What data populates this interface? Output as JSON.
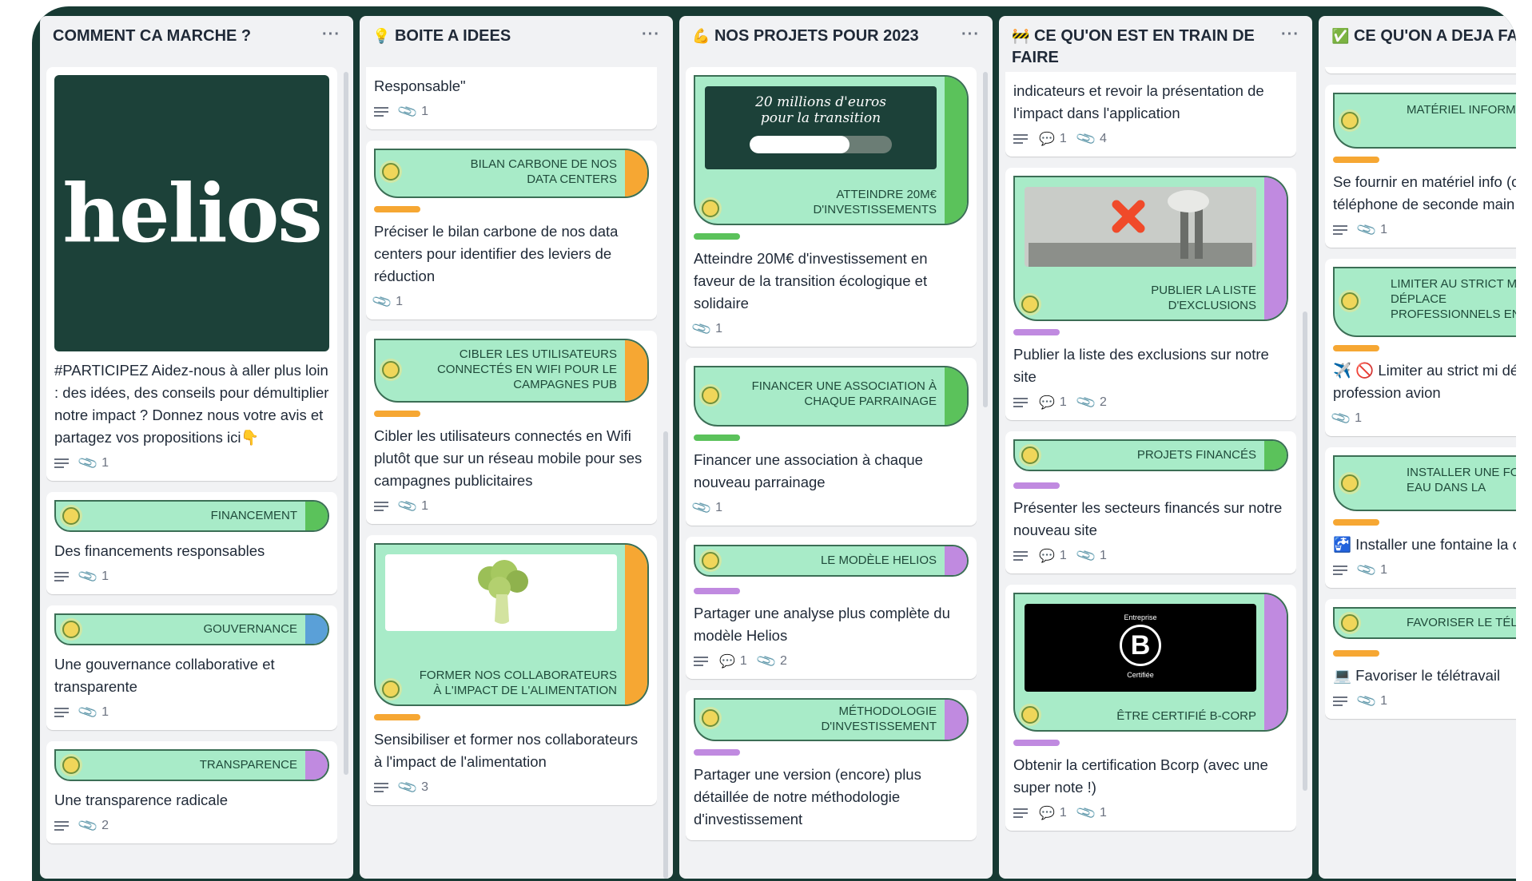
{
  "colors": {
    "frame": "#173a33",
    "banner": "#a8ebc8",
    "green": "#5bc25b",
    "blue": "#5aa0d8",
    "purple": "#c08ae0",
    "orange": "#f6a733"
  },
  "columns": [
    {
      "title": "COMMENT CA MARCHE ?",
      "icon": "",
      "cards": [
        {
          "cover": "helios",
          "title": "#PARTICIPEZ Aidez-nous à aller plus loin : des idées, des conseils pour démultiplier notre impact ? Donnez nous votre avis et partagez vos propositions ici👇",
          "attachments": "1"
        },
        {
          "banner": "FINANCEMENT",
          "title": "Des financements responsables",
          "attachments": "1"
        },
        {
          "banner": "GOUVERNANCE",
          "title": "Une gouvernance collaborative et transparente",
          "attachments": "1"
        },
        {
          "banner": "TRANSPARENCE",
          "title": "Une transparence radicale",
          "attachments": "2"
        }
      ]
    },
    {
      "title": "BOITE A IDEES",
      "icon": "💡",
      "cards": [
        {
          "title": "Responsable\"",
          "attachments": "1"
        },
        {
          "banner": "BILAN CARBONE DE NOS DATA CENTERS",
          "title": "Préciser le bilan carbone de nos data centers pour identifier des leviers de réduction",
          "attachments": "1"
        },
        {
          "banner": "CIBLER LES UTILISATEURS CONNECTÉS EN WIFI POUR LE CAMPAGNES PUB",
          "title": "Cibler les utilisateurs connectés en Wifi plutôt que sur un réseau mobile pour ses campagnes publicitaires",
          "attachments": "1"
        },
        {
          "banner": "FORMER NOS COLLABORATEURS À L'IMPACT DE L'ALIMENTATION",
          "image": "broccoli-image",
          "title": "Sensibiliser et former nos collaborateurs à l'impact de l'alimentation",
          "attachments": "3"
        }
      ]
    },
    {
      "title": "NOS PROJETS POUR 2023",
      "icon": "💪",
      "cards": [
        {
          "banner": "ATTEINDRE 20M€ D'INVESTISSEMENTS",
          "image_text_1": "20 millions d'euros",
          "image_text_2": "pour la transition",
          "progress": 0.7,
          "title": "Atteindre 20M€ d'investissement en faveur de la transition écologique et solidaire",
          "attachments": "1"
        },
        {
          "banner": "FINANCER UNE ASSOCIATION À CHAQUE PARRAINAGE",
          "title": "Financer une association à chaque nouveau parrainage",
          "attachments": "1"
        },
        {
          "banner": "LE MODÈLE HELIOS",
          "title": "Partager une analyse plus complète du modèle Helios",
          "comments": "1",
          "attachments": "2"
        },
        {
          "banner": "MÉTHODOLOGIE D'INVESTISSEMENT",
          "title": "Partager une version (encore) plus détaillée de notre méthodologie d'investissement"
        }
      ]
    },
    {
      "title": "CE QU'ON EST EN TRAIN DE FAIRE",
      "icon": "🚧",
      "cards": [
        {
          "title": "indicateurs et revoir la présentation de l'impact dans l'application",
          "comments": "1",
          "attachments": "4"
        },
        {
          "banner": "PUBLIER LA LISTE D'EXCLUSIONS",
          "image": "factory-image",
          "title": "Publier la liste des exclusions sur notre site",
          "comments": "1",
          "attachments": "2"
        },
        {
          "banner": "PROJETS FINANCÉS",
          "title": "Présenter les secteurs financés sur notre nouveau site",
          "comments": "1",
          "attachments": "1"
        },
        {
          "banner": "ÊTRE CERTIFIÉ B-CORP",
          "image_text_1": "Entreprise",
          "image_text_2": "Certifiée",
          "title": "Obtenir la certification Bcorp (avec une super note !)",
          "comments": "1",
          "attachments": "1"
        }
      ]
    },
    {
      "title": "CE QU'ON A DEJA FA",
      "icon": "✅",
      "cards": [
        {
          "banner": "MATÉRIEL INFORM DE SECOND",
          "title": "Se fournir en matériel info (clavier, souris, téléphone de seconde main (🙏 Bck",
          "attachments": "1"
        },
        {
          "banner": "LIMITER AU STRICT M LES DÉPLACE PROFESSIONNELS EN",
          "title": "✈️ 🚫 Limiter au strict mi déplacements profession avion",
          "attachments": "1"
        },
        {
          "banner": "INSTALLER UNE FO À EAU DANS LA",
          "title": "🚰 Installer une fontaine la cuisine",
          "attachments": "1"
        },
        {
          "banner": "FAVORISER LE TÉLÉT",
          "title": "💻 Favoriser le télétravail",
          "attachments": "1"
        }
      ]
    }
  ]
}
